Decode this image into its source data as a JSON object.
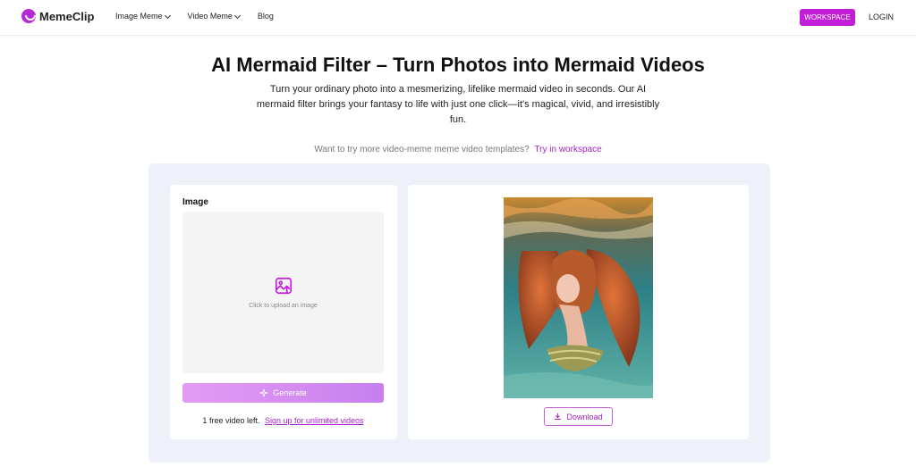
{
  "header": {
    "brand": "MemeClip",
    "nav": [
      {
        "label": "Image Meme",
        "has_dropdown": true
      },
      {
        "label": "Video Meme",
        "has_dropdown": true
      },
      {
        "label": "Blog",
        "has_dropdown": false
      }
    ],
    "workspace_label": "WORKSPACE",
    "login_label": "LOGIN"
  },
  "hero": {
    "title": "AI Mermaid Filter – Turn Photos into Mermaid Videos",
    "subtitle": "Turn your ordinary photo into a mesmerizing, lifelike mermaid video in seconds. Our AI mermaid filter brings your fantasy to life with just one click—it's magical, vivid, and irresistibly fun.",
    "try_text": "Want to try more video-meme meme video templates?",
    "try_link": "Try in workspace"
  },
  "tool": {
    "image_label": "Image",
    "upload_text": "Click to upload an image",
    "generate_label": "Generate",
    "free_count": "1",
    "free_text": "free video left.",
    "signup_link": "Sign up for unlimited videos",
    "download_label": "Download"
  },
  "colors": {
    "brand": "#c21ed8",
    "link": "#a51fc7",
    "panel_bg": "#eef0fa"
  },
  "icons": {
    "logo": "smile-logo-icon",
    "upload": "image-upload-icon",
    "generate": "sparkle-icon",
    "download": "download-icon"
  }
}
